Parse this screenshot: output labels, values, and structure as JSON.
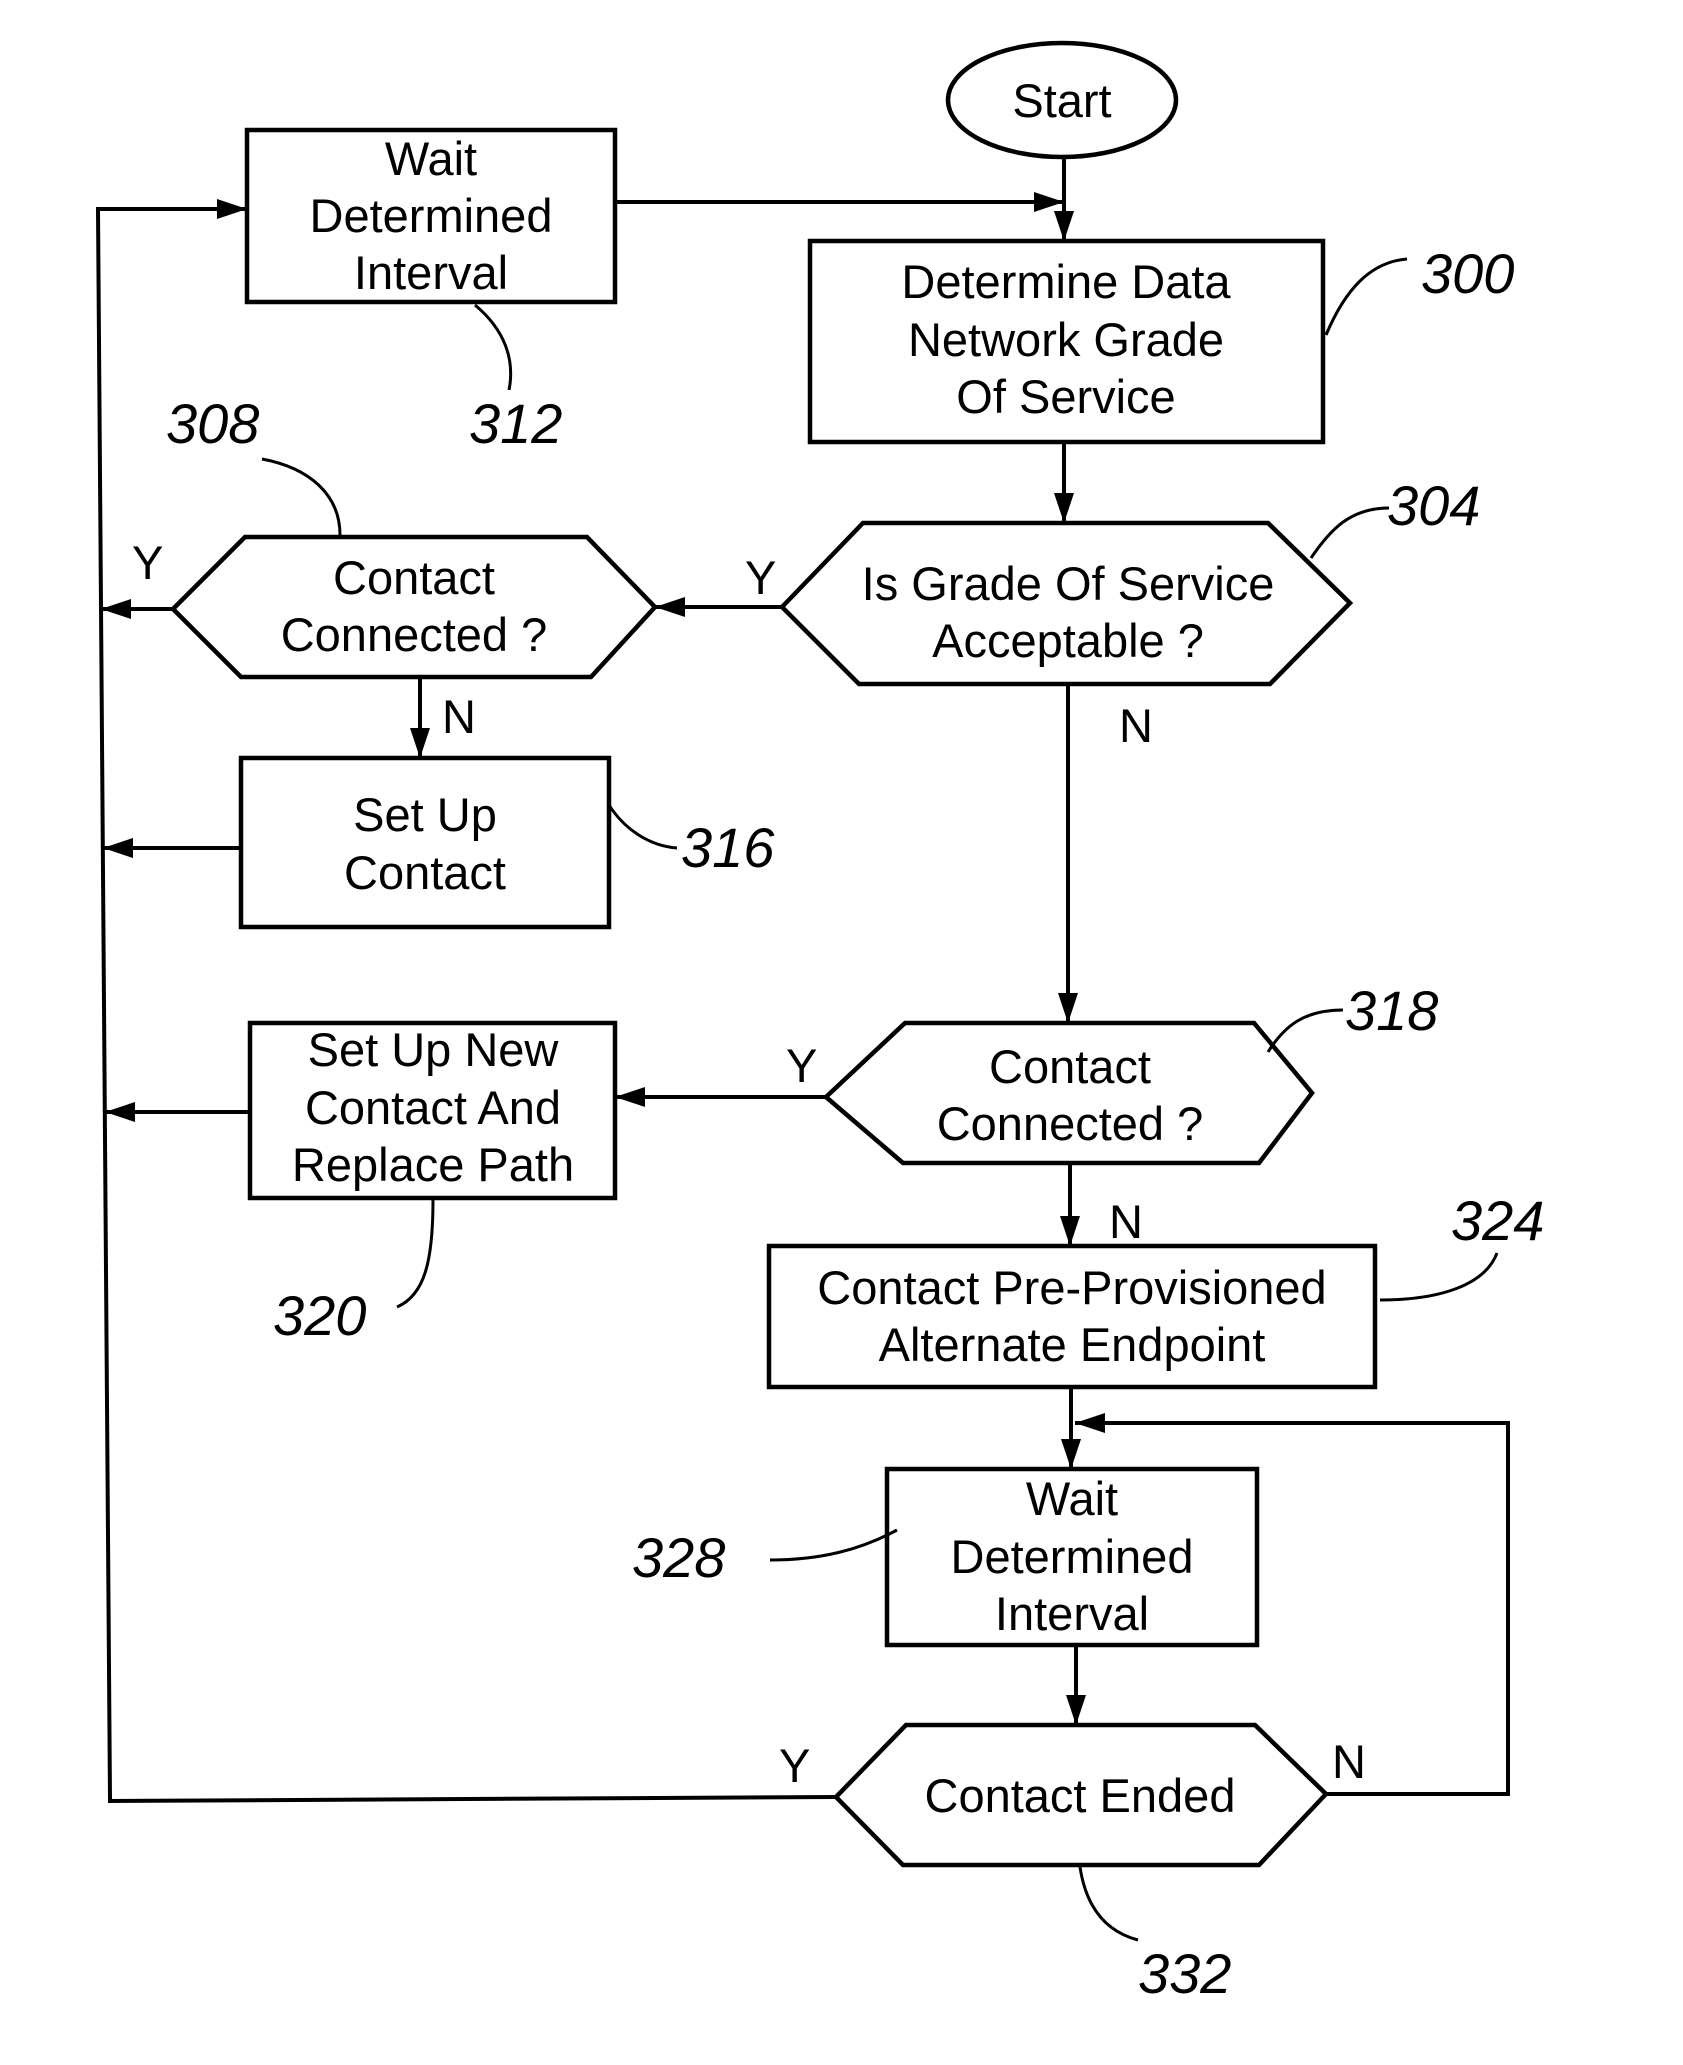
{
  "figure": {
    "kind": "flowchart",
    "background_color": "#ffffff",
    "ink_color": "#000000"
  },
  "nodes": {
    "start": {
      "shape": "terminator",
      "text": "Start"
    },
    "n300": {
      "ref": "300",
      "shape": "process",
      "lines": [
        "Determine Data",
        "Network Grade",
        "Of Service"
      ]
    },
    "n304": {
      "ref": "304",
      "shape": "decision",
      "lines": [
        "Is Grade Of Service",
        "Acceptable ?"
      ]
    },
    "n308": {
      "ref": "308",
      "shape": "decision",
      "lines": [
        "Contact",
        "Connected ?"
      ]
    },
    "n312": {
      "ref": "312",
      "shape": "process",
      "lines": [
        "Wait",
        "Determined",
        "Interval"
      ]
    },
    "n316": {
      "ref": "316",
      "shape": "process",
      "lines": [
        "Set Up",
        "Contact"
      ]
    },
    "n318": {
      "ref": "318",
      "shape": "decision",
      "lines": [
        "Contact",
        "Connected ?"
      ]
    },
    "n320": {
      "ref": "320",
      "shape": "process",
      "lines": [
        "Set Up New",
        "Contact And",
        "Replace Path"
      ]
    },
    "n324": {
      "ref": "324",
      "shape": "process",
      "lines": [
        "Contact Pre-Provisioned",
        "Alternate Endpoint"
      ]
    },
    "n328": {
      "ref": "328",
      "shape": "process",
      "lines": [
        "Wait",
        "Determined",
        "Interval"
      ]
    },
    "n332": {
      "ref": "332",
      "shape": "decision",
      "lines": [
        "Contact Ended"
      ]
    }
  },
  "edges": [
    {
      "from": "start",
      "to": "n300",
      "label": ""
    },
    {
      "from": "n312",
      "to": "n300",
      "label": ""
    },
    {
      "from": "n300",
      "to": "n304",
      "label": ""
    },
    {
      "from": "n304",
      "to": "n308",
      "label": "Y"
    },
    {
      "from": "n304",
      "to": "n318",
      "label": "N"
    },
    {
      "from": "n308",
      "to": "n312",
      "label": "Y"
    },
    {
      "from": "n308",
      "to": "n316",
      "label": "N"
    },
    {
      "from": "n316",
      "to": "n312",
      "label": ""
    },
    {
      "from": "n318",
      "to": "n320",
      "label": "Y"
    },
    {
      "from": "n318",
      "to": "n324",
      "label": "N"
    },
    {
      "from": "n320",
      "to": "n312",
      "label": ""
    },
    {
      "from": "n324",
      "to": "n328",
      "label": ""
    },
    {
      "from": "n328",
      "to": "n332",
      "label": ""
    },
    {
      "from": "n332",
      "to": "n312",
      "label": "Y"
    },
    {
      "from": "n332",
      "to": "n328",
      "label": "N"
    }
  ]
}
